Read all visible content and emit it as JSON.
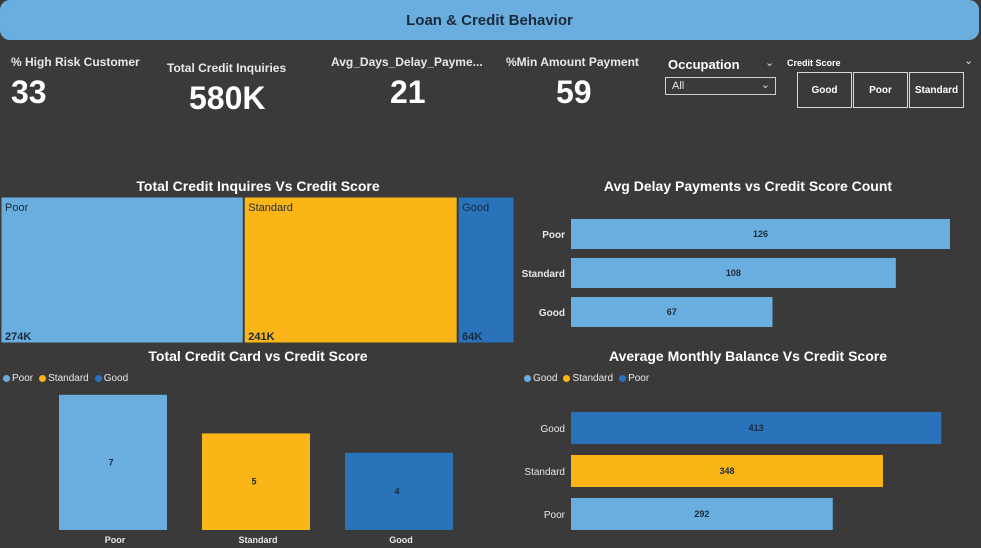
{
  "header": {
    "title": "Loan & Credit Behavior"
  },
  "kpis": [
    {
      "label": "% High Risk Customer",
      "value": "33"
    },
    {
      "label": "Total Credit Inquiries",
      "value": "580K"
    },
    {
      "label": "Avg_Days_Delay_Payme...",
      "value": "21"
    },
    {
      "label": "%Min Amount Payment",
      "value": "59"
    }
  ],
  "slicers": {
    "occupation": {
      "title": "Occupation",
      "selected": "All"
    },
    "credit_score": {
      "title": "Credit Score",
      "options": [
        "Good",
        "Poor",
        "Standard"
      ]
    }
  },
  "colors": {
    "Poor": "#6aaee0",
    "Standard": "#fbb517",
    "Good": "#2a72ba"
  },
  "chart_data": [
    {
      "type": "treemap",
      "title": "Total Credit Inquires Vs Credit Score",
      "categories": [
        "Poor",
        "Standard",
        "Good"
      ],
      "values": [
        274,
        241,
        64
      ],
      "value_labels": [
        "274K",
        "241K",
        "64K"
      ]
    },
    {
      "type": "bar",
      "orientation": "horizontal",
      "title": "Avg Delay Payments vs Credit Score Count",
      "categories": [
        "Poor",
        "Standard",
        "Good"
      ],
      "values": [
        126,
        108,
        67
      ],
      "xlim": [
        0,
        130
      ]
    },
    {
      "type": "bar",
      "title": "Total Credit Card vs Credit Score",
      "legend": [
        "Poor",
        "Standard",
        "Good"
      ],
      "legend_position": "top-left",
      "categories": [
        "Poor",
        "Standard",
        "Good"
      ],
      "values": [
        7,
        5,
        4
      ],
      "ylim": [
        0,
        7.3
      ]
    },
    {
      "type": "bar",
      "orientation": "horizontal",
      "title": "Average Monthly Balance Vs Credit Score",
      "legend": [
        "Good",
        "Standard",
        "Poor"
      ],
      "legend_position": "top-left",
      "categories": [
        "Good",
        "Standard",
        "Poor"
      ],
      "values": [
        413,
        348,
        292
      ],
      "xlim": [
        0,
        425
      ]
    }
  ]
}
